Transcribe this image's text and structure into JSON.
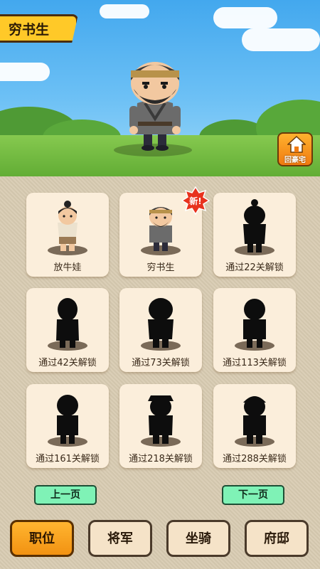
{
  "scene": {
    "character_name": "穷书生",
    "home_button_label": "回豪宅"
  },
  "characters": [
    {
      "label": "放牛娃",
      "unlocked": true
    },
    {
      "label": "穷书生",
      "unlocked": true,
      "is_new": true
    },
    {
      "label": "通过22关解锁",
      "unlocked": false
    },
    {
      "label": "通过42关解锁",
      "unlocked": false
    },
    {
      "label": "通过73关解锁",
      "unlocked": false
    },
    {
      "label": "通过113关解锁",
      "unlocked": false
    },
    {
      "label": "通过161关解锁",
      "unlocked": false
    },
    {
      "label": "通过218关解锁",
      "unlocked": false
    },
    {
      "label": "通过288关解锁",
      "unlocked": false
    }
  ],
  "new_badge": "新!",
  "pagination": {
    "prev_label": "上一页",
    "next_label": "下一页"
  },
  "tabs": [
    {
      "label": "职位",
      "active": true
    },
    {
      "label": "将军",
      "active": false
    },
    {
      "label": "坐骑",
      "active": false
    },
    {
      "label": "府邸",
      "active": false
    }
  ],
  "colors": {
    "active_tab": "#f29212",
    "page_button": "#7ff2b6",
    "card_bg": "#fbeedb"
  }
}
